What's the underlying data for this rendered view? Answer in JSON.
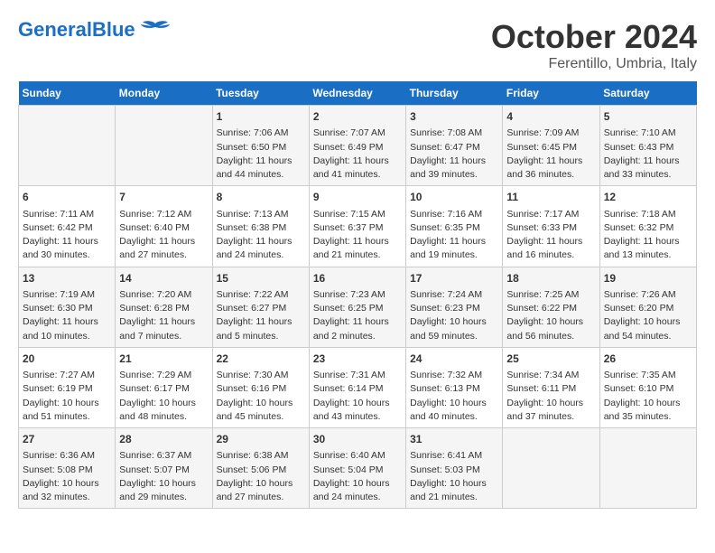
{
  "header": {
    "logo_general": "General",
    "logo_blue": "Blue",
    "month": "October 2024",
    "location": "Ferentillo, Umbria, Italy"
  },
  "days_of_week": [
    "Sunday",
    "Monday",
    "Tuesday",
    "Wednesday",
    "Thursday",
    "Friday",
    "Saturday"
  ],
  "weeks": [
    [
      {
        "day": "",
        "content": ""
      },
      {
        "day": "",
        "content": ""
      },
      {
        "day": "1",
        "content": "Sunrise: 7:06 AM\nSunset: 6:50 PM\nDaylight: 11 hours and 44 minutes."
      },
      {
        "day": "2",
        "content": "Sunrise: 7:07 AM\nSunset: 6:49 PM\nDaylight: 11 hours and 41 minutes."
      },
      {
        "day": "3",
        "content": "Sunrise: 7:08 AM\nSunset: 6:47 PM\nDaylight: 11 hours and 39 minutes."
      },
      {
        "day": "4",
        "content": "Sunrise: 7:09 AM\nSunset: 6:45 PM\nDaylight: 11 hours and 36 minutes."
      },
      {
        "day": "5",
        "content": "Sunrise: 7:10 AM\nSunset: 6:43 PM\nDaylight: 11 hours and 33 minutes."
      }
    ],
    [
      {
        "day": "6",
        "content": "Sunrise: 7:11 AM\nSunset: 6:42 PM\nDaylight: 11 hours and 30 minutes."
      },
      {
        "day": "7",
        "content": "Sunrise: 7:12 AM\nSunset: 6:40 PM\nDaylight: 11 hours and 27 minutes."
      },
      {
        "day": "8",
        "content": "Sunrise: 7:13 AM\nSunset: 6:38 PM\nDaylight: 11 hours and 24 minutes."
      },
      {
        "day": "9",
        "content": "Sunrise: 7:15 AM\nSunset: 6:37 PM\nDaylight: 11 hours and 21 minutes."
      },
      {
        "day": "10",
        "content": "Sunrise: 7:16 AM\nSunset: 6:35 PM\nDaylight: 11 hours and 19 minutes."
      },
      {
        "day": "11",
        "content": "Sunrise: 7:17 AM\nSunset: 6:33 PM\nDaylight: 11 hours and 16 minutes."
      },
      {
        "day": "12",
        "content": "Sunrise: 7:18 AM\nSunset: 6:32 PM\nDaylight: 11 hours and 13 minutes."
      }
    ],
    [
      {
        "day": "13",
        "content": "Sunrise: 7:19 AM\nSunset: 6:30 PM\nDaylight: 11 hours and 10 minutes."
      },
      {
        "day": "14",
        "content": "Sunrise: 7:20 AM\nSunset: 6:28 PM\nDaylight: 11 hours and 7 minutes."
      },
      {
        "day": "15",
        "content": "Sunrise: 7:22 AM\nSunset: 6:27 PM\nDaylight: 11 hours and 5 minutes."
      },
      {
        "day": "16",
        "content": "Sunrise: 7:23 AM\nSunset: 6:25 PM\nDaylight: 11 hours and 2 minutes."
      },
      {
        "day": "17",
        "content": "Sunrise: 7:24 AM\nSunset: 6:23 PM\nDaylight: 10 hours and 59 minutes."
      },
      {
        "day": "18",
        "content": "Sunrise: 7:25 AM\nSunset: 6:22 PM\nDaylight: 10 hours and 56 minutes."
      },
      {
        "day": "19",
        "content": "Sunrise: 7:26 AM\nSunset: 6:20 PM\nDaylight: 10 hours and 54 minutes."
      }
    ],
    [
      {
        "day": "20",
        "content": "Sunrise: 7:27 AM\nSunset: 6:19 PM\nDaylight: 10 hours and 51 minutes."
      },
      {
        "day": "21",
        "content": "Sunrise: 7:29 AM\nSunset: 6:17 PM\nDaylight: 10 hours and 48 minutes."
      },
      {
        "day": "22",
        "content": "Sunrise: 7:30 AM\nSunset: 6:16 PM\nDaylight: 10 hours and 45 minutes."
      },
      {
        "day": "23",
        "content": "Sunrise: 7:31 AM\nSunset: 6:14 PM\nDaylight: 10 hours and 43 minutes."
      },
      {
        "day": "24",
        "content": "Sunrise: 7:32 AM\nSunset: 6:13 PM\nDaylight: 10 hours and 40 minutes."
      },
      {
        "day": "25",
        "content": "Sunrise: 7:34 AM\nSunset: 6:11 PM\nDaylight: 10 hours and 37 minutes."
      },
      {
        "day": "26",
        "content": "Sunrise: 7:35 AM\nSunset: 6:10 PM\nDaylight: 10 hours and 35 minutes."
      }
    ],
    [
      {
        "day": "27",
        "content": "Sunrise: 6:36 AM\nSunset: 5:08 PM\nDaylight: 10 hours and 32 minutes."
      },
      {
        "day": "28",
        "content": "Sunrise: 6:37 AM\nSunset: 5:07 PM\nDaylight: 10 hours and 29 minutes."
      },
      {
        "day": "29",
        "content": "Sunrise: 6:38 AM\nSunset: 5:06 PM\nDaylight: 10 hours and 27 minutes."
      },
      {
        "day": "30",
        "content": "Sunrise: 6:40 AM\nSunset: 5:04 PM\nDaylight: 10 hours and 24 minutes."
      },
      {
        "day": "31",
        "content": "Sunrise: 6:41 AM\nSunset: 5:03 PM\nDaylight: 10 hours and 21 minutes."
      },
      {
        "day": "",
        "content": ""
      },
      {
        "day": "",
        "content": ""
      }
    ]
  ]
}
